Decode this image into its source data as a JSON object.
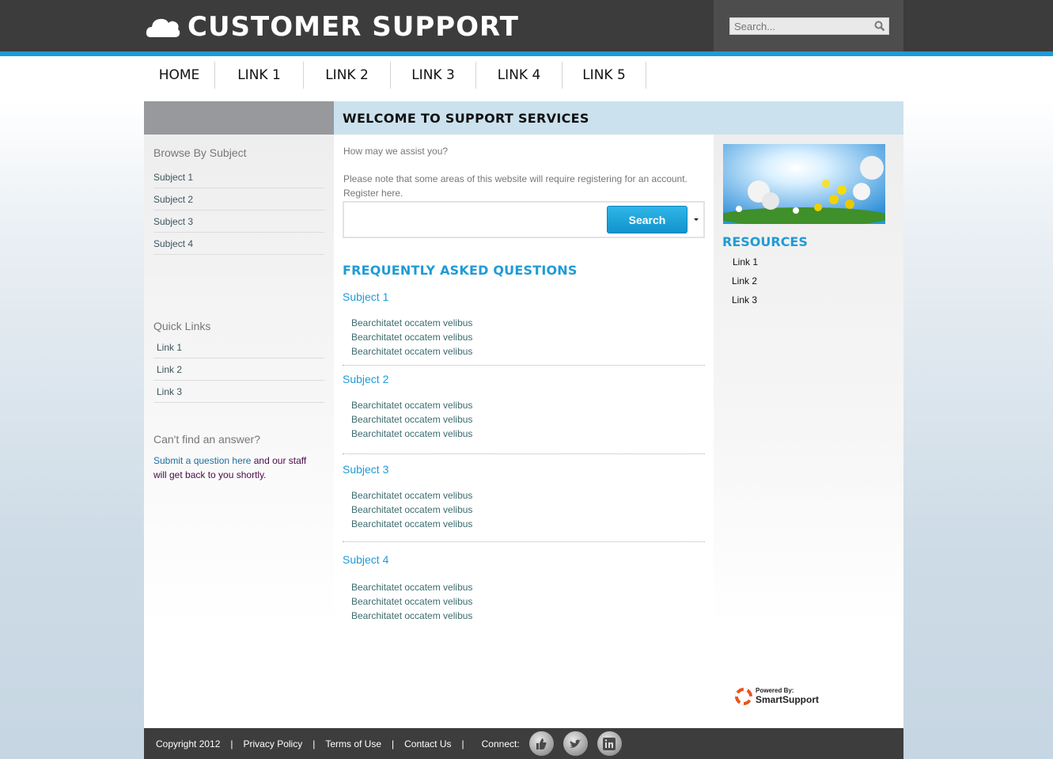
{
  "header": {
    "title": "CUSTOMER SUPPORT",
    "search_placeholder": "Search..."
  },
  "nav": {
    "items": [
      "HOME",
      "LINK 1",
      "LINK 2",
      "LINK 3",
      "LINK 4",
      "LINK 5"
    ]
  },
  "main": {
    "heading": "WELCOME TO SUPPORT SERVICES",
    "assist": "How may we assist you?",
    "note": "Please note that some areas of this website will require registering for an account. Register here.",
    "search_button": "Search",
    "faq_title": "FREQUENTLY ASKED QUESTIONS",
    "faq": [
      {
        "subject": "Subject 1",
        "items": [
          "Bearchitatet occatem velibus",
          "Bearchitatet occatem velibus",
          "Bearchitatet occatem velibus"
        ]
      },
      {
        "subject": "Subject 2",
        "items": [
          "Bearchitatet occatem velibus",
          "Bearchitatet occatem velibus",
          "Bearchitatet occatem velibus"
        ]
      },
      {
        "subject": "Subject 3",
        "items": [
          "Bearchitatet occatem velibus",
          "Bearchitatet occatem velibus",
          "Bearchitatet occatem velibus"
        ]
      },
      {
        "subject": "Subject 4",
        "items": [
          "Bearchitatet occatem velibus",
          "Bearchitatet occatem velibus",
          "Bearchitatet occatem velibus"
        ]
      }
    ]
  },
  "sidebar": {
    "browse_title": "Browse By Subject",
    "subjects": [
      "Subject 1",
      "Subject 2",
      "Subject 3",
      "Subject 4"
    ],
    "quick_title": "Quick Links",
    "quick_links": [
      "Link 1",
      "Link 2",
      "Link 3"
    ],
    "cant_title": "Can't find an answer?",
    "cant_link": "Submit a question here",
    "cant_text": " and our staff will get back to you shortly."
  },
  "resources": {
    "title": "RESOURCES",
    "links": [
      "Link 1",
      "Link 2",
      "Link 3"
    ],
    "powered_by": "Powered By:",
    "brand": "SmartSupport"
  },
  "footer": {
    "copyright": "Copyright 2012",
    "privacy": "Privacy Policy",
    "terms": "Terms of Use",
    "contact": "Contact Us",
    "connect": "Connect:",
    "social": [
      "thumbs-up-icon",
      "twitter-icon",
      "linkedin-icon"
    ]
  },
  "colors": {
    "accent": "#1f9bd7",
    "header_bg": "#3c3c3c",
    "heading_bg": "#cbe1ee"
  }
}
